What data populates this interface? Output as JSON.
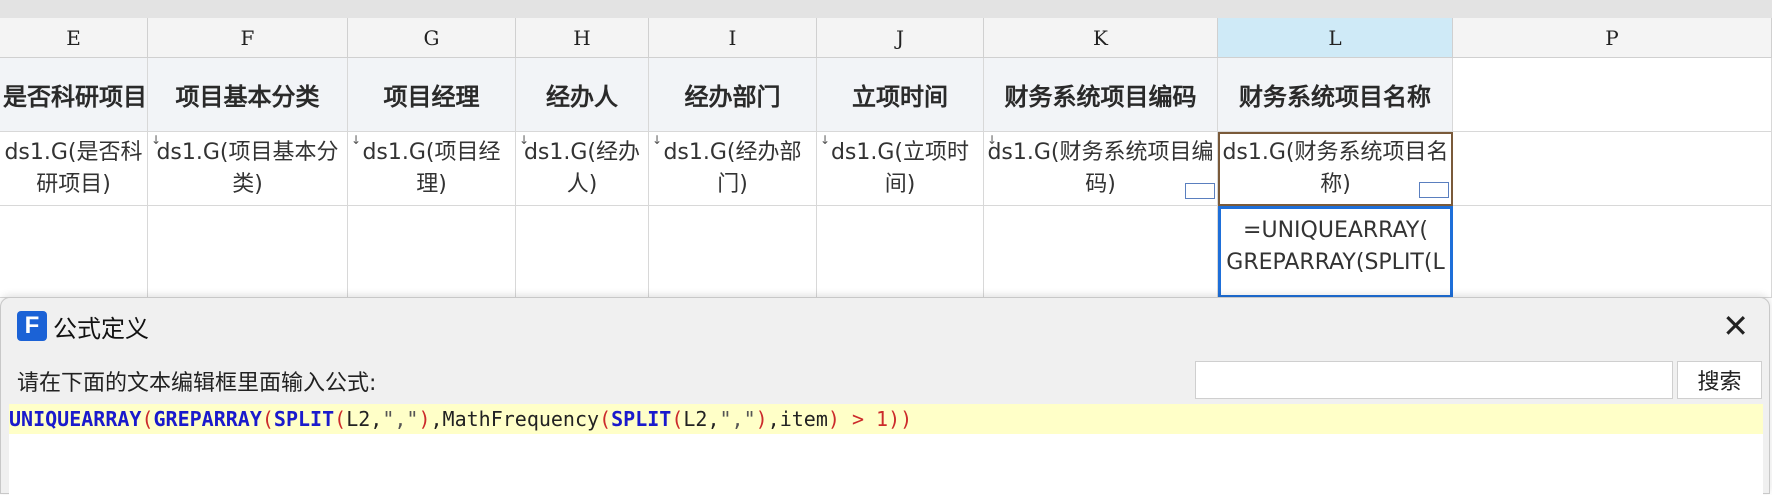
{
  "spreadsheet": {
    "columns": [
      {
        "letter": "E",
        "header": "是否科研项目",
        "binding": "ds1.G(是否科研项目)"
      },
      {
        "letter": "F",
        "header": "项目基本分类",
        "binding": "ds1.G(项目基本分类)"
      },
      {
        "letter": "G",
        "header": "项目经理",
        "binding": "ds1.G(项目经理)"
      },
      {
        "letter": "H",
        "header": "经办人",
        "binding": "ds1.G(经办人)"
      },
      {
        "letter": "I",
        "header": "经办部门",
        "binding": "ds1.G(经办部门)"
      },
      {
        "letter": "J",
        "header": "立项时间",
        "binding": "ds1.G(立项时间)"
      },
      {
        "letter": "K",
        "header": "财务系统项目编码",
        "binding": "ds1.G(财务系统项目编码)"
      },
      {
        "letter": "L",
        "header": "财务系统项目名称",
        "binding": "ds1.G(财务系统项目名称)"
      },
      {
        "letter": "P",
        "header": "",
        "binding": ""
      }
    ],
    "selected_cell_formula": "=UNIQUEARRAY( GREPARRAY(SPLIT(L"
  },
  "dialog": {
    "title": "公式定义",
    "logo_letter": "F",
    "prompt": "请在下面的文本编辑框里面输入公式:",
    "search_placeholder": "",
    "search_button": "搜索",
    "formula_tokens": [
      {
        "t": "UNIQUEARRAY",
        "c": "fn"
      },
      {
        "t": "(",
        "c": "par"
      },
      {
        "t": "GREPARRAY",
        "c": "fn"
      },
      {
        "t": "(",
        "c": "par"
      },
      {
        "t": "SPLIT",
        "c": "fn"
      },
      {
        "t": "(",
        "c": "par"
      },
      {
        "t": "L2,",
        "c": "txt"
      },
      {
        "t": "\",\"",
        "c": "str"
      },
      {
        "t": ")",
        "c": "par"
      },
      {
        "t": ",MathFrequency",
        "c": "txt"
      },
      {
        "t": "(",
        "c": "par"
      },
      {
        "t": "SPLIT",
        "c": "fn"
      },
      {
        "t": "(",
        "c": "par"
      },
      {
        "t": "L2,",
        "c": "txt"
      },
      {
        "t": "\",\"",
        "c": "str"
      },
      {
        "t": ")",
        "c": "par"
      },
      {
        "t": ",item",
        "c": "txt"
      },
      {
        "t": ") > 1))",
        "c": "par"
      }
    ]
  },
  "colors": {
    "accent": "#1e6fd9",
    "selected_header": "#cfeaf7",
    "highlight_line": "#ffffc8"
  }
}
